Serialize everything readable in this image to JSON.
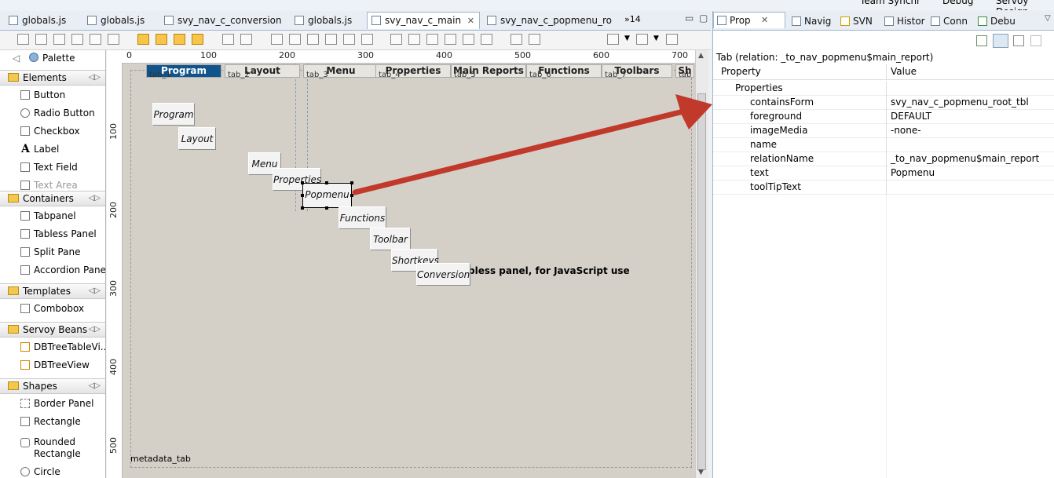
{
  "top_strip": {
    "items": [
      "Team Synchr",
      "Debug",
      "Servoy Design"
    ]
  },
  "editor_tabs": [
    {
      "label": "globals.js"
    },
    {
      "label": "globals.js"
    },
    {
      "label": "svy_nav_c_conversion"
    },
    {
      "label": "globals.js"
    },
    {
      "label": "svy_nav_c_main",
      "active": true
    },
    {
      "label": "svy_nav_c_popmenu_ro"
    }
  ],
  "editor_tabs_overflow": "»14",
  "palette": {
    "title": "Palette",
    "sections": [
      {
        "label": "Elements",
        "items": [
          "Button",
          "Radio Button",
          "Checkbox",
          "Label",
          "Text Field",
          "Text Area"
        ]
      },
      {
        "label": "Containers",
        "items": [
          "Tabpanel",
          "Tabless Panel",
          "Split Pane",
          "Accordion Panel"
        ]
      },
      {
        "label": "Templates",
        "items": [
          "Combobox"
        ]
      },
      {
        "label": "Servoy Beans",
        "items": [
          "DBTreeTableVi...",
          "DBTreeView"
        ]
      },
      {
        "label": "Shapes",
        "items": [
          "Border Panel",
          "Rectangle",
          "Rounded Rectangle",
          "Circle"
        ]
      }
    ]
  },
  "ruler": {
    "top": [
      "0",
      "100",
      "200",
      "300",
      "400",
      "500",
      "600",
      "700"
    ],
    "left": [
      "100",
      "200",
      "300",
      "400",
      "500"
    ]
  },
  "canvas": {
    "tabs": [
      {
        "label": "Program",
        "sub": "tab_1"
      },
      {
        "label": "Layout",
        "sub": "tab_2"
      },
      {
        "label": "Menu",
        "sub": "tab_3"
      },
      {
        "label": "Properties",
        "sub": "tab_4"
      },
      {
        "label": "Main Reports",
        "sub": "tab_5"
      },
      {
        "label": "Functions",
        "sub": "tab_6"
      },
      {
        "label": "Toolbars",
        "sub": "tab_7"
      },
      {
        "label": "Sh",
        "sub": "tab_8"
      }
    ],
    "buttons": [
      "Program",
      "Layout",
      "Menu",
      "Properties",
      "Popmenu",
      "Functions",
      "Toolbar",
      "Shortkeys",
      "Conversion"
    ],
    "note": "bless panel, for JavaScript use",
    "footer_label": "metadata_tab"
  },
  "right_panel": {
    "tabs": [
      "Prop",
      "Navig",
      "SVN",
      "Histor",
      "Conn",
      "Debu"
    ],
    "title": "Tab (relation: _to_nav_popmenu$main_report)",
    "columns": {
      "property": "Property",
      "value": "Value"
    },
    "group": "Properties",
    "rows": [
      {
        "key": "containsForm",
        "value": "svy_nav_c_popmenu_root_tbl"
      },
      {
        "key": "foreground",
        "value": "DEFAULT"
      },
      {
        "key": "imageMedia",
        "value": "-none-"
      },
      {
        "key": "name",
        "value": ""
      },
      {
        "key": "relationName",
        "value": "_to_nav_popmenu$main_report"
      },
      {
        "key": "text",
        "value": "Popmenu"
      },
      {
        "key": "toolTipText",
        "value": ""
      }
    ]
  },
  "colors": {
    "arrow": "#c0392b",
    "selected_tab": "#10548c",
    "canvas_bg": "#d4d0c8"
  }
}
